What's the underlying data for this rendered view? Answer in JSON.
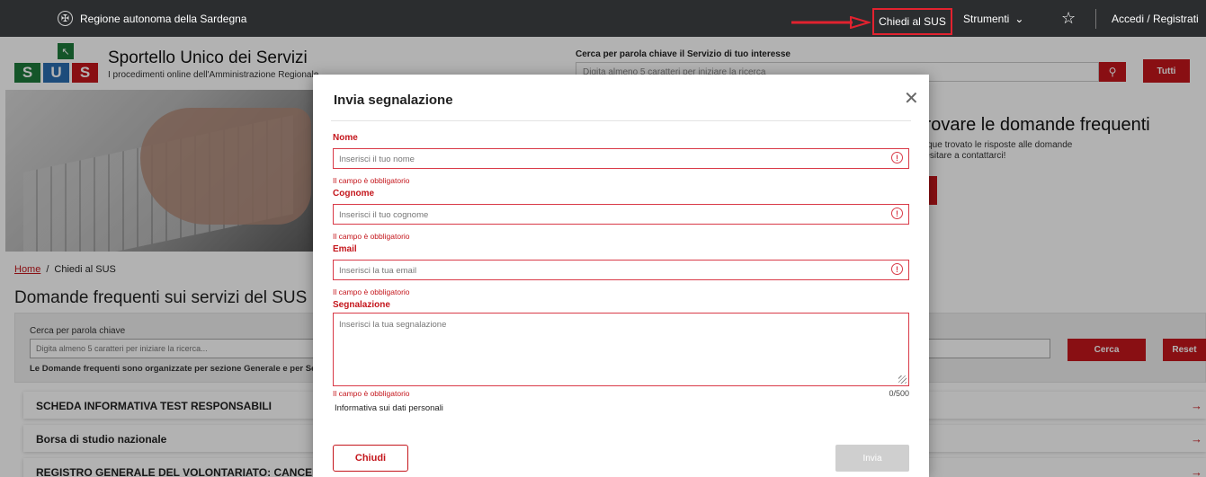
{
  "topbar": {
    "region_name": "Regione autonoma della Sardegna",
    "chiedi_label": "Chiedi al SUS",
    "strumenti_label": "Strumenti",
    "accedi_label": "Accedi / Registrati",
    "annotation_color": "#e2222f"
  },
  "header": {
    "logo_letters": [
      "S",
      "U",
      "S"
    ],
    "logo_colors": [
      "#1d7a3c",
      "#2a6db0",
      "#c4161c"
    ],
    "title": "Sportello Unico dei Servizi",
    "subtitle": "I procedimenti online dell'Amministrazione Regionale",
    "search_label": "Cerca per parola chiave il Servizio di tuo interesse",
    "search_placeholder": "Digita almeno 5 caratteri per iniziare la ricerca",
    "tutti_label": "Tutti"
  },
  "hero": {
    "title": "i trovare le domande frequenti",
    "text_line1": "unque trovato le risposte alle domande",
    "text_line2": "n esitare a contattarci!"
  },
  "breadcrumb": {
    "home": "Home",
    "separator": "/",
    "current": "Chiedi al SUS"
  },
  "page_title": "Domande frequenti sui servizi del SUS",
  "search_panel": {
    "label": "Cerca per parola chiave",
    "placeholder": "Digita almeno 5 caratteri per iniziare la ricerca...",
    "note": "Le Domande frequenti sono organizzate per sezione Generale e per Servizi",
    "cerca_label": "Cerca",
    "reset_label": "Reset"
  },
  "faq_items": [
    "SCHEDA INFORMATIVA TEST RESPONSABILI",
    "Borsa di studio nazionale",
    "REGISTRO GENERALE DEL VOLONTARIATO: CANCELLAZIONE"
  ],
  "modal": {
    "title": "Invia segnalazione",
    "fields": [
      {
        "label": "Nome",
        "placeholder": "Inserisci il tuo nome",
        "error": "Il campo è obbligatorio"
      },
      {
        "label": "Cognome",
        "placeholder": "Inserisci il tuo cognome",
        "error": "Il campo è obbligatorio"
      },
      {
        "label": "Email",
        "placeholder": "Inserisci la tua email",
        "error": "Il campo è obbligatorio"
      }
    ],
    "textarea": {
      "label": "Segnalazione",
      "placeholder": "Inserisci la tua segnalazione",
      "error": "Il campo è obbligatorio",
      "counter": "0/500"
    },
    "privacy": "Informativa sui dati personali",
    "chiudi_label": "Chiudi",
    "invia_label": "Invia"
  },
  "colors": {
    "accent": "#c4161c",
    "topbar": "#2b2d2f",
    "error": "#d93a48"
  }
}
